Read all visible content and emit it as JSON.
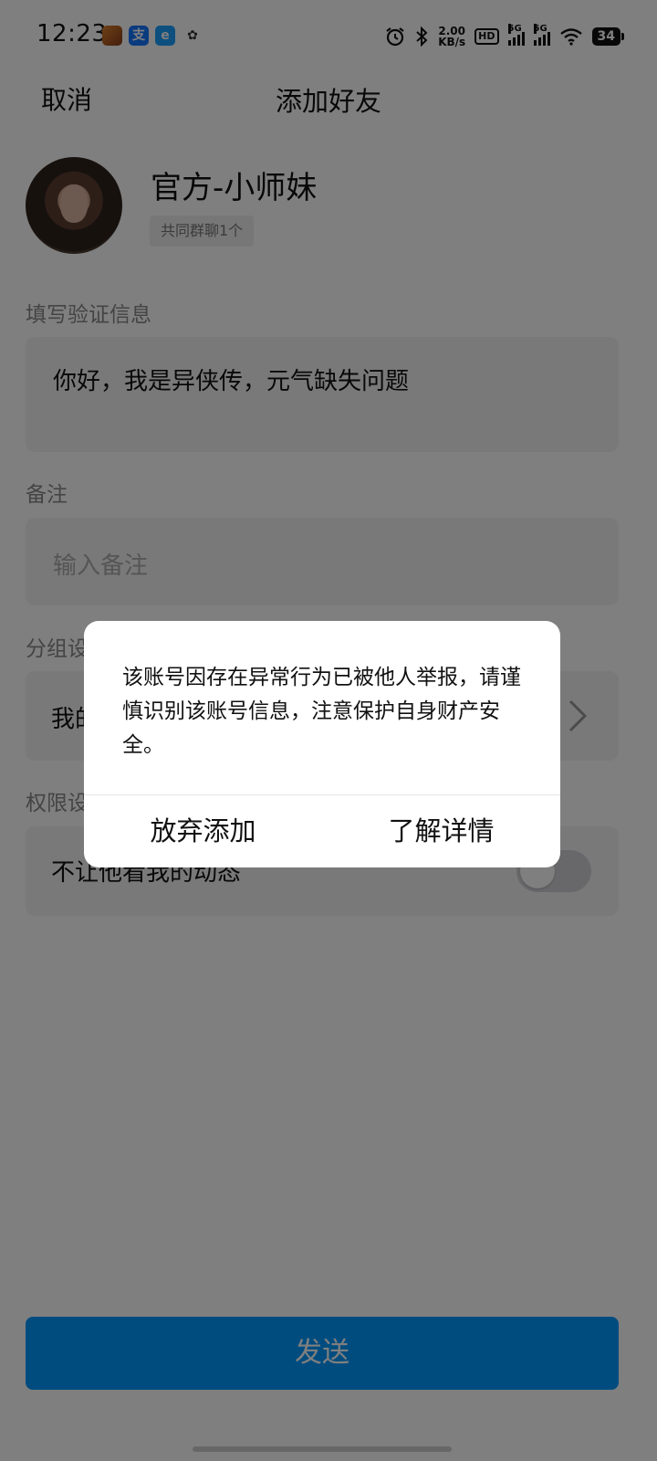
{
  "status_bar": {
    "time": "12:23",
    "alipay_glyph": "支",
    "ele_glyph": "e",
    "wechat_glyph": "✿",
    "speed_value": "2.00",
    "speed_unit": "KB/s",
    "hd": "HD",
    "sim1_tag": "5G",
    "sim2_tag": "5G",
    "battery": "34",
    "icons": [
      "game-app-icon",
      "alipay-icon",
      "ele-me-icon",
      "wechat-icon",
      "alarm-icon",
      "bluetooth-icon",
      "wifi-icon",
      "battery-icon"
    ]
  },
  "header": {
    "cancel_label": "取消",
    "title": "添加好友"
  },
  "profile": {
    "name": "官方-小师妹",
    "common_groups": "共同群聊1个"
  },
  "verify": {
    "label": "填写验证信息",
    "value": "你好，我是异侠传，元气缺失问题"
  },
  "remark": {
    "label": "备注",
    "placeholder": "输入备注"
  },
  "group": {
    "label": "分组设置",
    "value": "我的好友"
  },
  "permission": {
    "label": "权限设置",
    "option": "不让他看我的动态",
    "toggle_on": false
  },
  "send_label": "发送",
  "dialog": {
    "message": "该账号因存在异常行为已被他人举报，请谨慎识别该账号信息，注意保护自身财产安全。",
    "abandon_label": "放弃添加",
    "details_label": "了解详情"
  },
  "colors": {
    "accent": "#0099ff",
    "overlay": "rgba(0,0,0,0.5)"
  }
}
